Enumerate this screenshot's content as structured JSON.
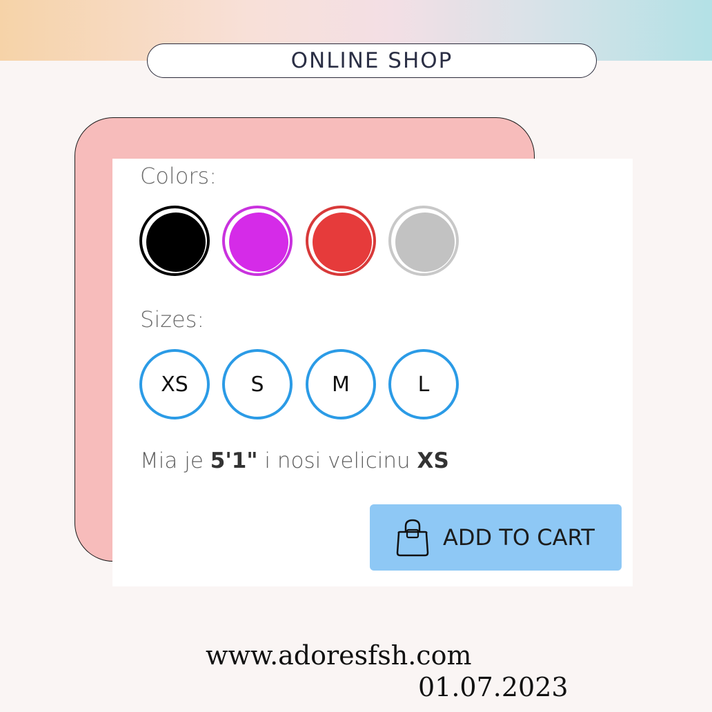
{
  "header": {
    "title": "ONLINE SHOP"
  },
  "product": {
    "colors_label": "Colors:",
    "colors": [
      {
        "name": "black",
        "hex": "#000000",
        "ring": "#000000"
      },
      {
        "name": "purple",
        "hex": "#d52be8",
        "ring": "#c932de"
      },
      {
        "name": "red",
        "hex": "#e63b3b",
        "ring": "#d83a3a"
      },
      {
        "name": "grey",
        "hex": "#c2c2c2",
        "ring": "#c8c8c8"
      }
    ],
    "sizes_label": "Sizes:",
    "sizes": [
      "XS",
      "S",
      "M",
      "L"
    ],
    "model_note": {
      "prefix": "Mia je ",
      "height": "5'1\"",
      "middle": " i nosi velicinu ",
      "size": "XS"
    },
    "add_to_cart_label": "ADD TO CART",
    "cart_icon": "shopping-bag-icon"
  },
  "footer": {
    "url": "www.adoresfsh.com",
    "date": "01.07.2023"
  },
  "colors": {
    "accent_blue": "#2b9be6",
    "button_blue": "#8ec8f5",
    "card_pink": "#f7bcbb"
  }
}
